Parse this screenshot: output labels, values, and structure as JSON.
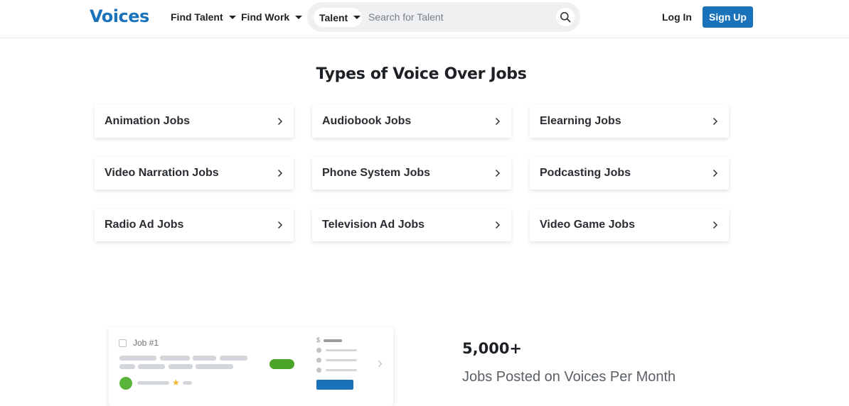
{
  "header": {
    "logo": "Voices",
    "nav": [
      {
        "label": "Find Talent"
      },
      {
        "label": "Find Work"
      }
    ],
    "search": {
      "category": "Talent",
      "placeholder": "Search for Talent"
    },
    "login_label": "Log In",
    "signup_label": "Sign Up"
  },
  "jobs_section": {
    "title": "Types of Voice Over Jobs",
    "jobs": [
      {
        "label": "Animation Jobs"
      },
      {
        "label": "Audiobook Jobs"
      },
      {
        "label": "Elearning Jobs"
      },
      {
        "label": "Video Narration Jobs"
      },
      {
        "label": "Phone System Jobs"
      },
      {
        "label": "Podcasting Jobs"
      },
      {
        "label": "Radio Ad Jobs"
      },
      {
        "label": "Television Ad Jobs"
      },
      {
        "label": "Video Game Jobs"
      }
    ]
  },
  "illustration": {
    "job_name": "Job #1",
    "currency_symbol": "$"
  },
  "stats": {
    "number": "5,000+",
    "description": "Jobs Posted on Voices Per Month"
  },
  "colors": {
    "brand": "#1a73ba",
    "accent_green": "#4aa428",
    "star": "#f0b429"
  },
  "icons": {
    "search": "search-icon",
    "caret": "caret-down-icon",
    "chevron": "chevron-right-icon"
  }
}
